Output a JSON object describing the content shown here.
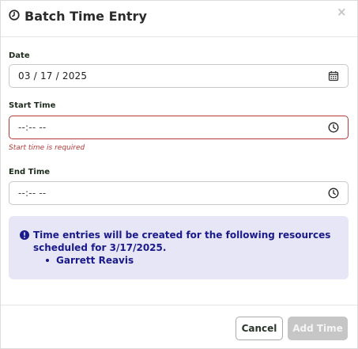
{
  "modal": {
    "title": "Batch Time Entry",
    "title_icon": "clock-icon",
    "close_label": "×"
  },
  "date": {
    "label": "Date",
    "value": "03 / 17 / 2025",
    "icon": "calendar-icon"
  },
  "start_time": {
    "label": "Start Time",
    "value": "--:-- --",
    "icon": "clock-icon",
    "error": "Start time is required"
  },
  "end_time": {
    "label": "End Time",
    "value": "--:-- --",
    "icon": "clock-icon"
  },
  "info": {
    "icon": "info-circle-icon",
    "message": "Time entries will be created for the following resources scheduled for 3/17/2025.",
    "resources": [
      "Garrett Reavis"
    ]
  },
  "footer": {
    "cancel_label": "Cancel",
    "add_label": "Add Time"
  },
  "colors": {
    "error": "#b23a3a",
    "info_bg": "#e6e6f6",
    "info_text": "#1a1a8a",
    "disabled_button": "#c6c6c6"
  }
}
